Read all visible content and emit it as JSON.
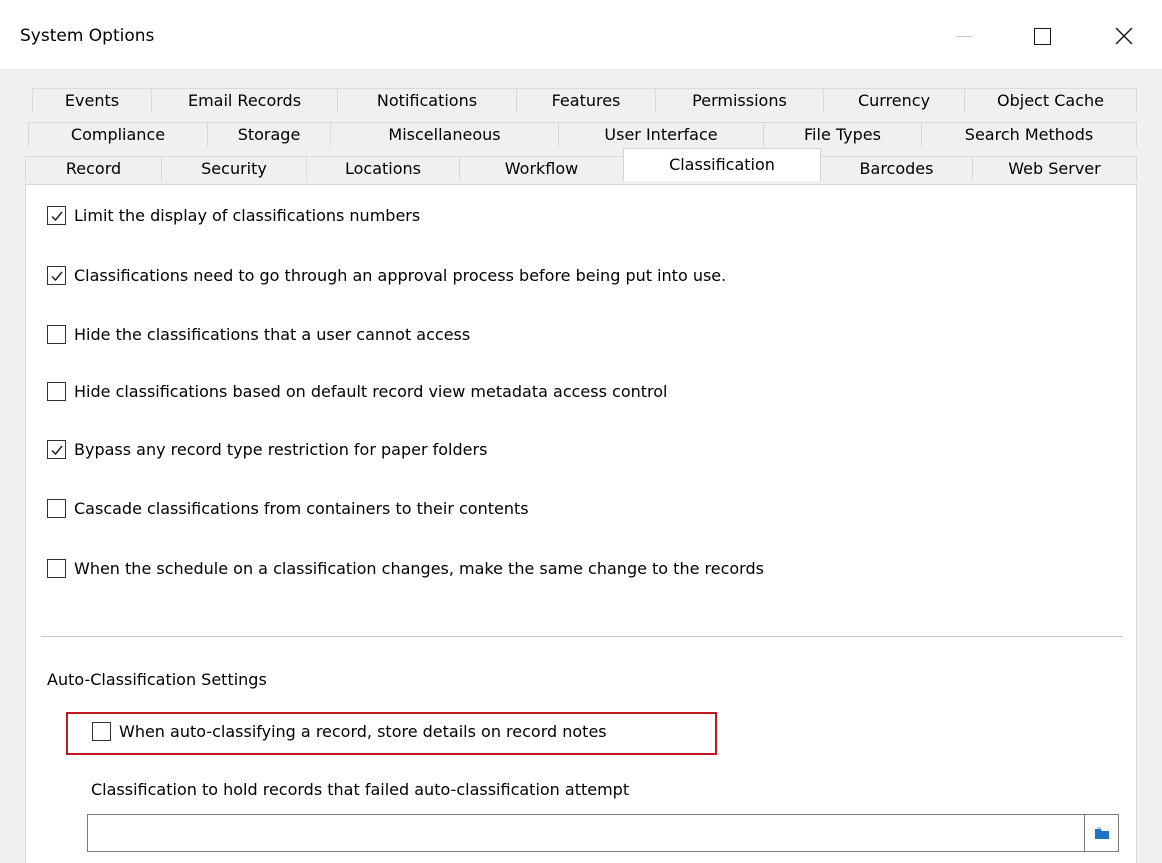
{
  "window": {
    "title": "System Options",
    "controls": {
      "minimize": "minimize-icon",
      "maximize": "maximize-icon",
      "close": "close-icon"
    }
  },
  "tabs": {
    "row1": [
      "Events",
      "Email Records",
      "Notifications",
      "Features",
      "Permissions",
      "Currency",
      "Object Cache"
    ],
    "row2": [
      "Compliance",
      "Storage",
      "Miscellaneous",
      "User Interface",
      "File Types",
      "Search Methods"
    ],
    "row3": [
      "Record",
      "Security",
      "Locations",
      "Workflow",
      "Classification",
      "Barcodes",
      "Web Server"
    ],
    "active": "Classification"
  },
  "options": [
    {
      "label": "Limit the display of classifications numbers",
      "checked": true
    },
    {
      "label": "Classifications need to go through an approval process before being put into use.",
      "checked": true
    },
    {
      "label": "Hide the classifications that a user cannot access",
      "checked": false
    },
    {
      "label": "Hide classifications based on default record view metadata access control",
      "checked": false
    },
    {
      "label": "Bypass any record type restriction for paper folders",
      "checked": true
    },
    {
      "label": "Cascade classifications from containers to their contents",
      "checked": false
    },
    {
      "label": "When the schedule on a classification changes, make the same change to the records",
      "checked": false
    }
  ],
  "auto_classification": {
    "section_title": "Auto-Classification Settings",
    "store_details": {
      "label": "When auto-classifying a record, store details on record notes",
      "checked": false
    },
    "failed_classification_label": "Classification to hold records that failed auto-classification attempt",
    "failed_classification_value": "",
    "browse_icon": "folder-icon"
  },
  "colors": {
    "highlight": "#c0191f",
    "folder": "#1e74c6"
  }
}
